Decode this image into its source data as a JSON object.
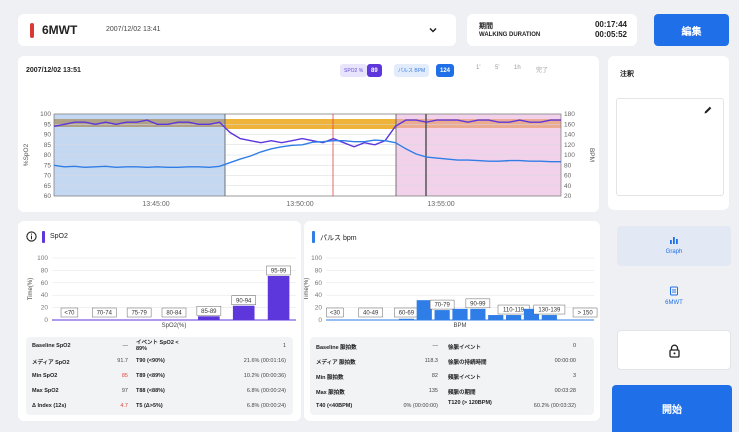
{
  "header": {
    "title": "6MWT",
    "datetime": "2007/12/02 13:41",
    "accent": "#d93a35"
  },
  "duration": {
    "title": "期間",
    "subtitle": "WALKING DURATION",
    "time1": "00:17:44",
    "time2": "00:05:52"
  },
  "edit_label": "編集",
  "chart_header": {
    "datetime": "2007/12/02 13:51",
    "spo2_label": "SPO2 %",
    "spo2_value": "89",
    "pulse_label": "パルス BPM",
    "pulse_value": "124",
    "segments": [
      "1'",
      "5'",
      "1h",
      "完了"
    ]
  },
  "chart_data": [
    {
      "type": "line",
      "ylabel": "%SpO2",
      "y2label": "BPM",
      "x_ticks": [
        "13:45:00",
        "13:50:00",
        "13:55:00"
      ],
      "y_ticks": [
        100,
        95,
        90,
        85,
        80,
        75,
        70,
        65,
        60
      ],
      "y2_ticks": [
        180,
        160,
        140,
        120,
        100,
        80,
        60,
        40,
        20
      ],
      "ylim": [
        60,
        100
      ],
      "y2lim": [
        20,
        180
      ],
      "series": [
        {
          "values": [
            94,
            95,
            96,
            96,
            95,
            96,
            95,
            96,
            96,
            97,
            95,
            95,
            96,
            96,
            95,
            95,
            96,
            91,
            88,
            87,
            86,
            87,
            86,
            87,
            88,
            87,
            86,
            88,
            86,
            84,
            86,
            85,
            87,
            94,
            97,
            97,
            96,
            97,
            97,
            97,
            96,
            97,
            97,
            96,
            96,
            97,
            96,
            96,
            97,
            97
          ],
          "color": "#5d36dc"
        },
        {
          "values": [
            80,
            77,
            78,
            76,
            77,
            78,
            76,
            77,
            77,
            76,
            77,
            76,
            76,
            77,
            77,
            76,
            78,
            85,
            92,
            98,
            106,
            112,
            116,
            119,
            120,
            125,
            126,
            128,
            128,
            126,
            126,
            129,
            128,
            124,
            112,
            102,
            96,
            94,
            92,
            90,
            90,
            89,
            88,
            88,
            89,
            89,
            88,
            88,
            87,
            87
          ],
          "color": "#2f7de6"
        }
      ]
    },
    {
      "type": "bar",
      "title": "SpO2",
      "xlabel": "SpO2(%)",
      "ylabel": "Time(%)",
      "y_ticks": [
        100,
        80,
        60,
        40,
        20,
        0
      ],
      "ylim": [
        0,
        100
      ],
      "categories": [
        "<70",
        "70-74",
        "75-79",
        "80-84",
        "85-89",
        "90-94",
        "95-99"
      ],
      "values": [
        0,
        0,
        0,
        0,
        6,
        23,
        71
      ],
      "color": "#5d36dc"
    },
    {
      "type": "bar",
      "title": "パルス bpm",
      "xlabel": "BPM",
      "ylabel": "Time(%)",
      "y_ticks": [
        100,
        80,
        60,
        40,
        20,
        0
      ],
      "ylim": [
        0,
        100
      ],
      "categories": [
        "<30",
        "",
        "40-49",
        "",
        "60-69",
        "",
        "70-79",
        "",
        "90-99",
        "",
        "110-119",
        "",
        "130-139",
        "",
        "> 150"
      ],
      "values": [
        0,
        0,
        0,
        0,
        2,
        32,
        16,
        18,
        18,
        8,
        8,
        18,
        8,
        0,
        0
      ],
      "color": "#2f7de6"
    }
  ],
  "spo2_card": {
    "title": "SpO2",
    "accent": "#5d36dc",
    "stats_left": [
      {
        "label": "Baseline SpO2",
        "value": "—"
      },
      {
        "label": "メディア SpO2",
        "value": "91.7"
      },
      {
        "label": "Min SpO2",
        "value": "85"
      },
      {
        "label": "Max SpO2",
        "value": "97"
      },
      {
        "label": "Δ Index (12s)",
        "value": "4.7"
      }
    ],
    "stats_right": [
      {
        "label": "イベント SpO2 < 89%",
        "value": "1"
      },
      {
        "label": "T90 (<90%)",
        "value": "21.6% (00:01:16)"
      },
      {
        "label": "T89 (<89%)",
        "value": "10.2% (00:00:36)"
      },
      {
        "label": "T88 (<88%)",
        "value": "6.8% (00:00:24)"
      },
      {
        "label": "T5 (Δ>5%)",
        "value": "6.8% (00:00:24)"
      }
    ]
  },
  "pulse_card": {
    "title": "パルス bpm",
    "accent": "#2f7de6",
    "stats_left": [
      {
        "label": "Baseline 脈拍数",
        "value": "—"
      },
      {
        "label": "メディア 脈拍数",
        "value": "118.3"
      },
      {
        "label": "Min 脈拍数",
        "value": "82"
      },
      {
        "label": "Max 脈拍数",
        "value": "135"
      },
      {
        "label": "T40 (<40BPM)",
        "value": "0% (00:00:00)"
      }
    ],
    "stats_right": [
      {
        "label": "徐脈イベント",
        "value": "0"
      },
      {
        "label": "徐脈の持続時間",
        "value": "00:00:00"
      },
      {
        "label": "頻脈イベント",
        "value": "3"
      },
      {
        "label": "頻脈の期間",
        "value": "00:03:28"
      },
      {
        "label": "T120 (> 120BPM)",
        "value": "60.2% (00:03:32)"
      }
    ]
  },
  "notes": {
    "title": "注釈"
  },
  "side": {
    "graph_label": "Graph",
    "mwt_label": "6MWT",
    "start_label": "開始"
  },
  "colors": {
    "primary": "#1f6fe8",
    "spo2": "#5d36dc",
    "pulse": "#2f7de6",
    "red": "#e0463e"
  }
}
